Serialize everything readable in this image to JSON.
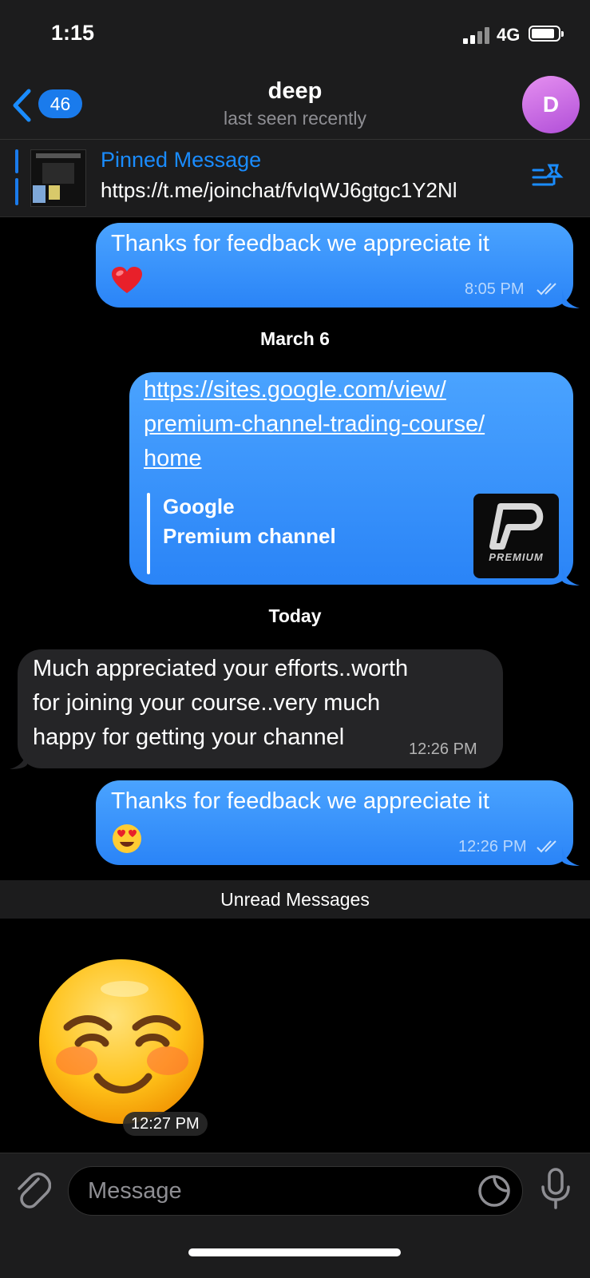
{
  "status_bar": {
    "time": "1:15",
    "network": "4G"
  },
  "header": {
    "back_count": "46",
    "title": "deep",
    "subtitle": "last seen recently",
    "avatar_letter": "D"
  },
  "pinned": {
    "label": "Pinned Message",
    "text": "https://t.me/joinchat/fvIqWJ6gtgc1Y2Nl"
  },
  "messages": [
    {
      "direction": "out",
      "text": "Thanks for feedback we appreciate it",
      "emoji": "red-heart",
      "time": "8:05 PM",
      "read": true
    },
    {
      "date_separator": "March 6"
    },
    {
      "direction": "out",
      "link_lines": [
        "https://sites.google.com/view/",
        "premium-channel-trading-course/",
        "home"
      ],
      "preview": {
        "site": "Google",
        "title": "Premium channel",
        "image_text": "PREMIUM"
      }
    },
    {
      "date_separator": "Today"
    },
    {
      "direction": "in",
      "lines": [
        "Much appreciated your efforts..worth",
        "for joining your course..very much",
        "happy for getting your channel"
      ],
      "time": "12:26 PM"
    },
    {
      "direction": "out",
      "text": "Thanks for feedback we appreciate it",
      "emoji": "heart-eyes",
      "time": "12:26 PM",
      "read": true
    },
    {
      "unread_separator": "Unread Messages"
    },
    {
      "direction": "in",
      "sticker": "smiling-face-sticker",
      "time": "12:27 PM"
    }
  ],
  "input": {
    "placeholder": "Message"
  },
  "colors": {
    "accent": "#1a7bec",
    "outgoing_bubble": "#3493fb",
    "incoming_bubble": "#252527"
  }
}
